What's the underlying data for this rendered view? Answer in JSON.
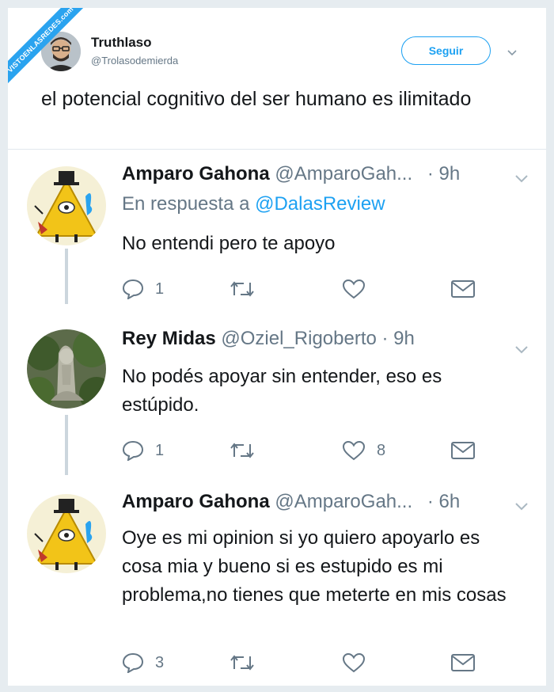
{
  "watermark": {
    "text": "VISTOENLASREDES.com"
  },
  "header_tweet": {
    "name": "Truthlaso",
    "handle": "@Trolasodemierda",
    "follow_label": "Seguir",
    "text": "el potencial cognitivo del ser humano es ilimitado"
  },
  "replies": [
    {
      "name": "Amparo Gahona",
      "handle": "@AmparoGah...",
      "time": "· 9h",
      "in_reply_prefix": "En respuesta a",
      "in_reply_mention": "@DalasReview",
      "text": "No entendi pero te apoyo",
      "reply_count": "1",
      "retweet_count": "",
      "like_count": ""
    },
    {
      "name": "Rey Midas",
      "handle": "@Oziel_Rigoberto",
      "time": "· 9h",
      "text": "No podés apoyar sin entender, eso es estúpido.",
      "reply_count": "1",
      "retweet_count": "",
      "like_count": "8"
    },
    {
      "name": "Amparo Gahona",
      "handle": "@AmparoGah...",
      "time": "· 6h",
      "text": "Oye es mi opinion si yo quiero apoyarlo es cosa mia y bueno si es estupido es mi problema,no tienes que meterte en mis cosas",
      "reply_count": "3",
      "retweet_count": "",
      "like_count": ""
    }
  ],
  "colors": {
    "accent": "#1da1f2",
    "muted": "#657786",
    "text": "#14171a",
    "background": "#e6ecf0",
    "thread_line": "#ccd6dd"
  }
}
